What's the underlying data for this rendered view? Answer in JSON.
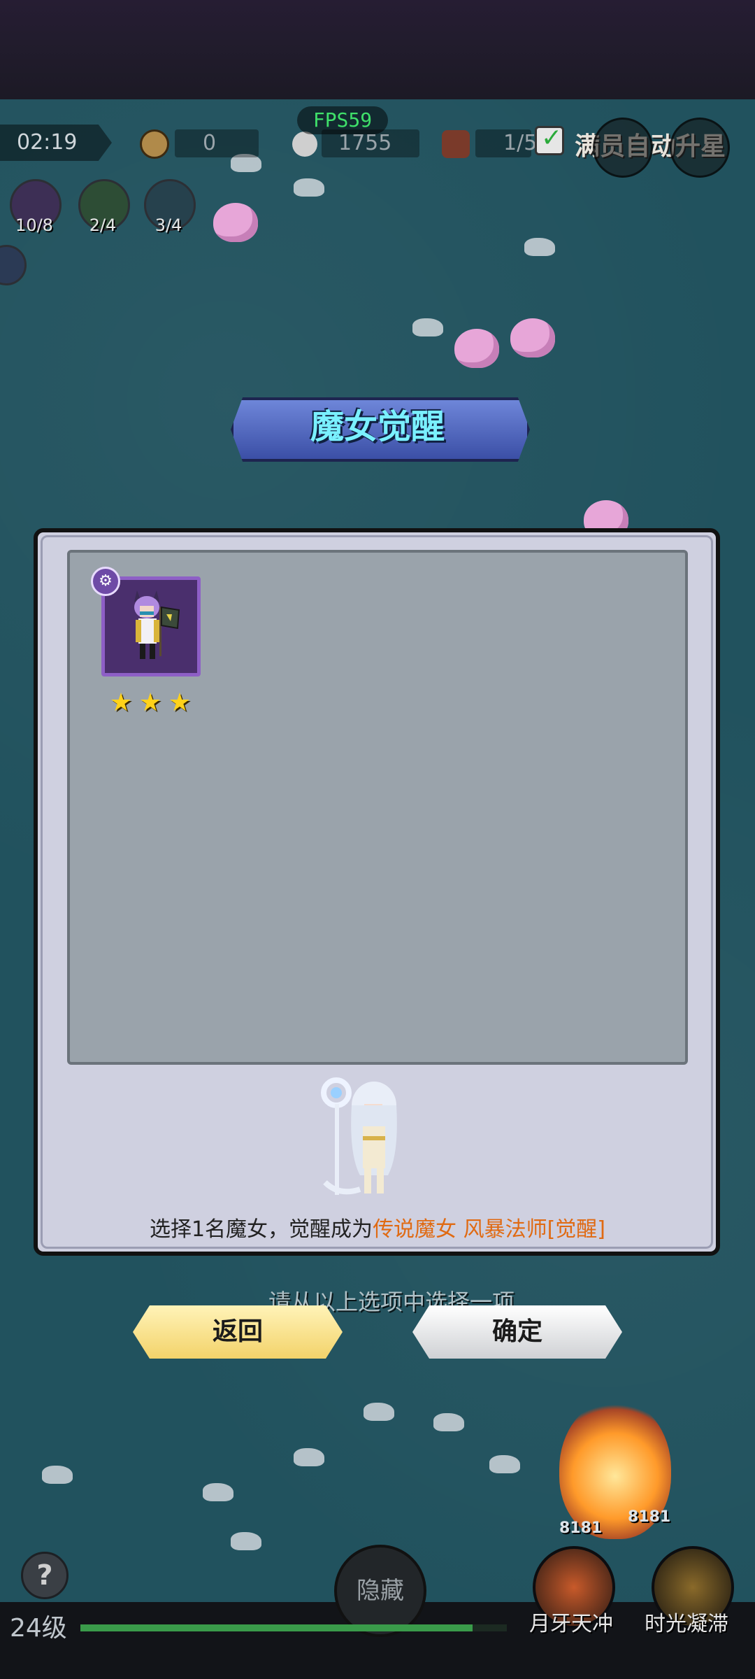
{
  "hud": {
    "timer": "02:19",
    "coins": "0",
    "kills": "1755",
    "fps": "FPS59",
    "boss_progress": "1/5",
    "auto_upgrade_label": "满员自动升星",
    "auto_upgrade_checked": true
  },
  "skills": [
    {
      "icon": "gear-skill-icon",
      "count": "10/8"
    },
    {
      "icon": "feather-skill-icon",
      "count": "2/4"
    },
    {
      "icon": "lightning-skill-icon",
      "count": "3/4"
    }
  ],
  "dialog": {
    "title": "魔女觉醒",
    "candidate": {
      "name": "purple-hair-witch",
      "stars": 3,
      "star_glyph": "★"
    },
    "instruction_prefix": "选择1名魔女，觉醒成为",
    "instruction_highlight": "传说魔女 风暴法师[觉醒]"
  },
  "hint": "请从以上选项中选择一项",
  "buttons": {
    "back": "返回",
    "confirm": "确定"
  },
  "damage_numbers": [
    "8181",
    "8181"
  ],
  "bottom": {
    "help": "?",
    "hide": "隐藏",
    "level": "24级",
    "xp_fraction": 0.92,
    "skill_left": "月牙天冲",
    "skill_right": "时光凝滞"
  },
  "colors": {
    "highlight": "#e06a12",
    "title": "#7af0ff",
    "fps": "#3fe06a",
    "card_border": "#8e5fc6"
  }
}
